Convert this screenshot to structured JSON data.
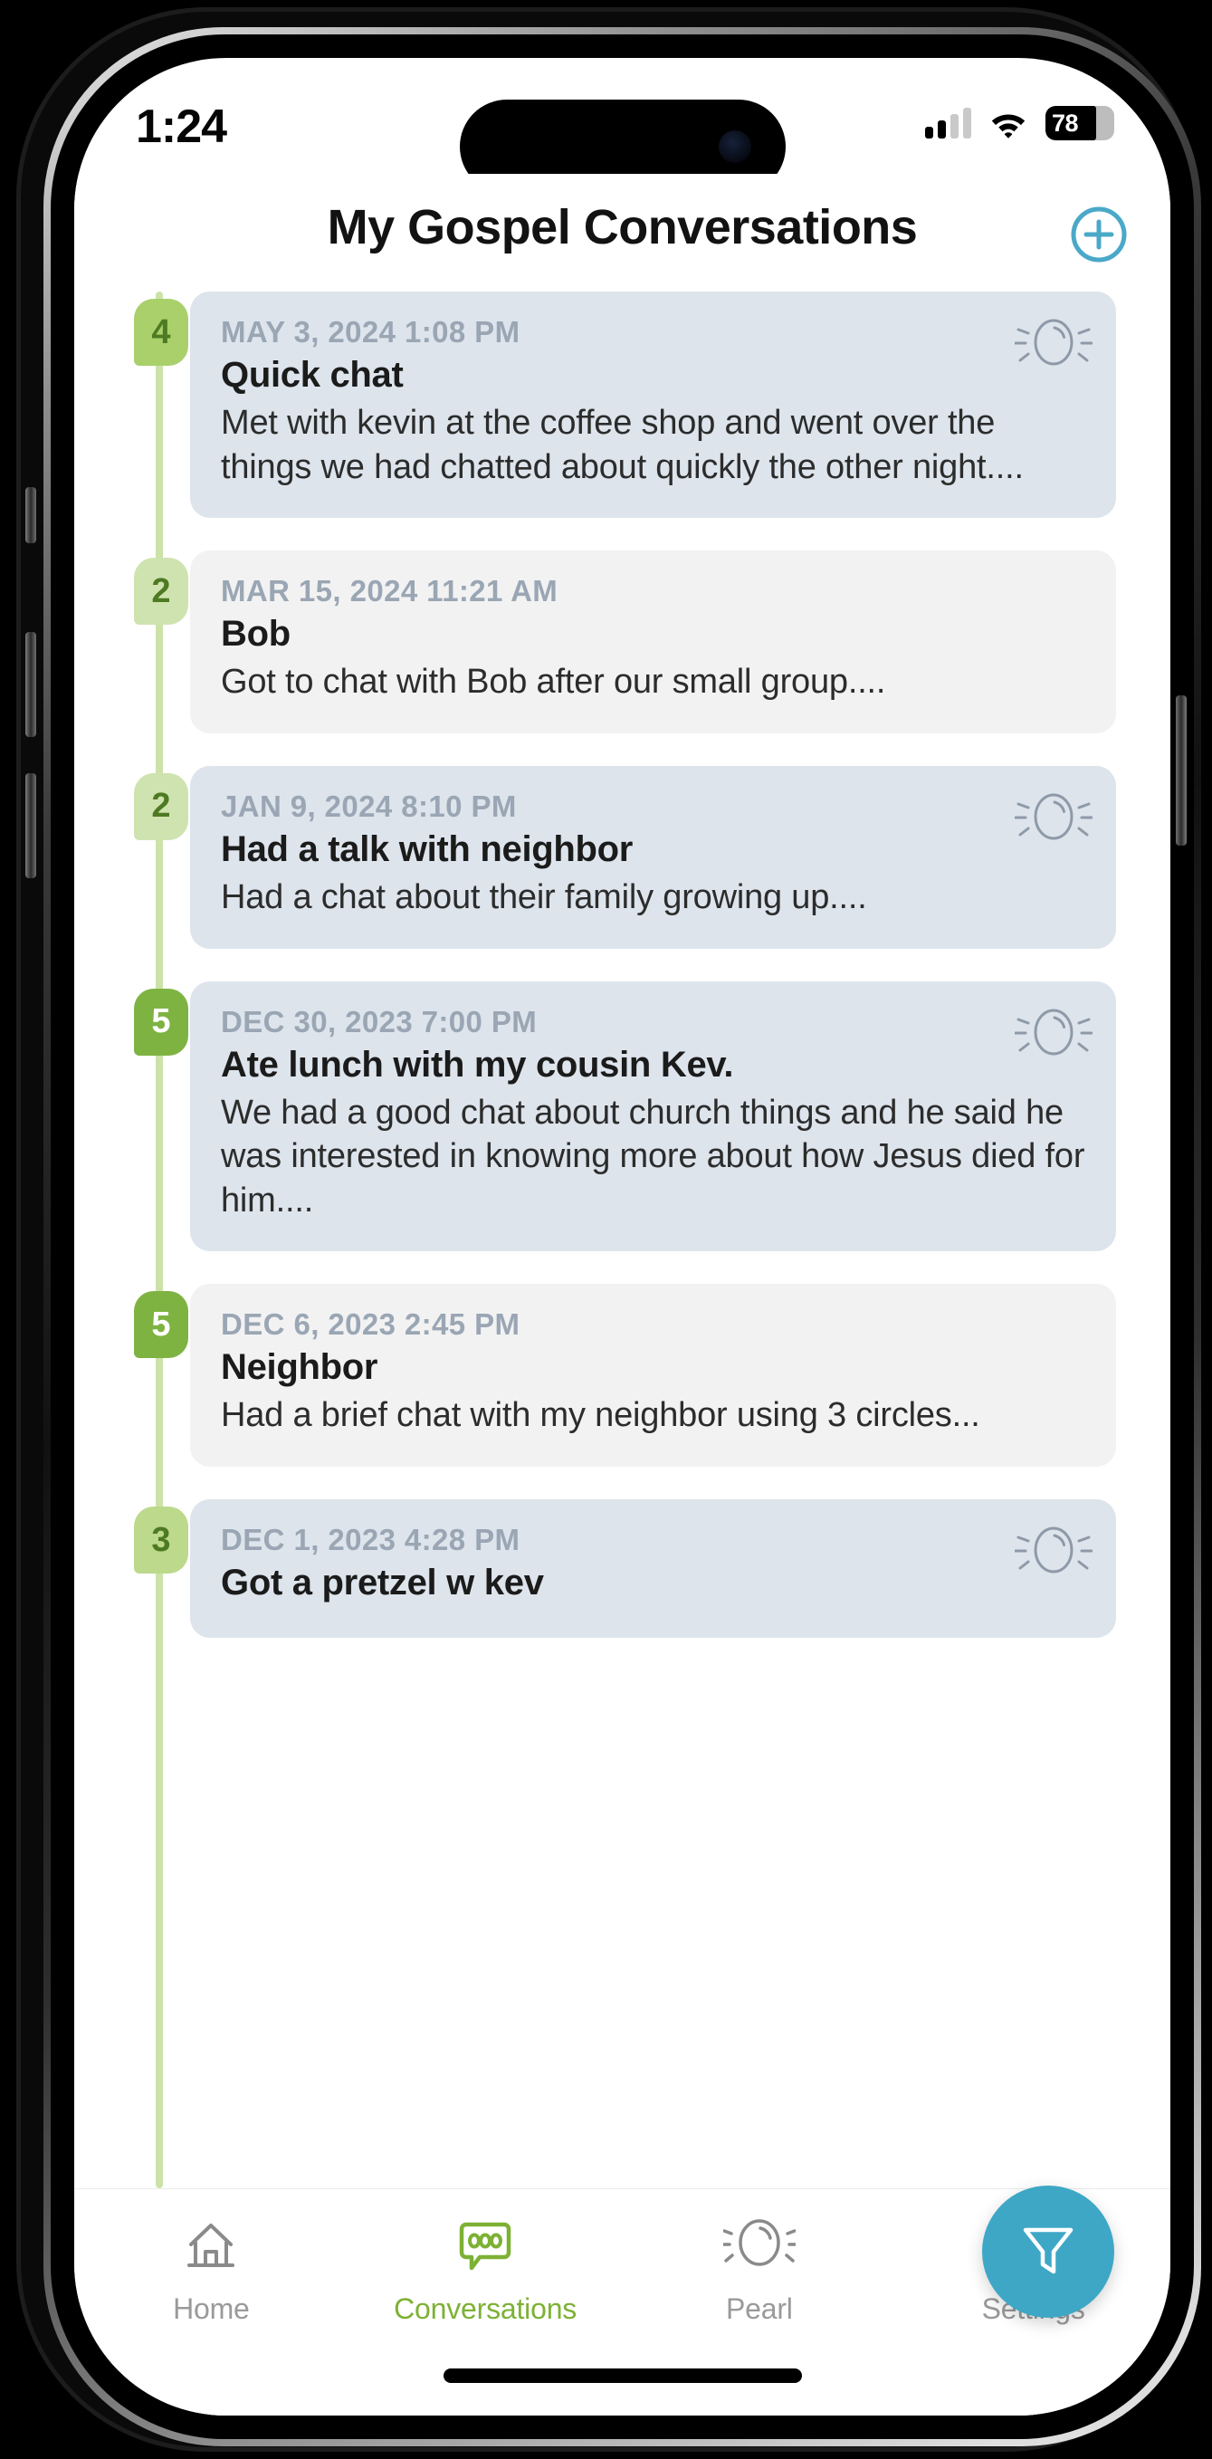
{
  "status_bar": {
    "time": "1:24",
    "battery_percent": "78",
    "cellular_icon": "cellular-signal-icon",
    "wifi_icon": "wifi-icon",
    "battery_icon": "battery-icon",
    "signal_bars_filled": 2,
    "signal_bars_total": 4
  },
  "header": {
    "title": "My Gospel Conversations",
    "add_icon": "plus-circle-icon",
    "accent_color": "#4aa8c8"
  },
  "theme": {
    "rail_color": "#cde2a8",
    "card_blue": "#dde4ec",
    "card_gray": "#f2f2f2",
    "badge_light": "#cfe3b0",
    "badge_medium": "#a9d06b",
    "badge_strong": "#7eb342",
    "fab_color": "#3ea7c6",
    "active_nav_color": "#7db135"
  },
  "conversations": [
    {
      "badge": "4",
      "badge_level": "medium",
      "date": "MAY 3, 2024 1:08 PM",
      "title": "Quick chat",
      "preview": "Met with kevin at the coffee shop and went over the things we had chatted about quickly the other night....",
      "card_style": "blue",
      "has_pearl": true
    },
    {
      "badge": "2",
      "badge_level": "light",
      "date": "MAR 15, 2024 11:21 AM",
      "title": "Bob",
      "preview": "Got to chat with Bob after our small group....",
      "card_style": "gray",
      "has_pearl": false
    },
    {
      "badge": "2",
      "badge_level": "light",
      "date": "JAN 9, 2024 8:10 PM",
      "title": "Had a talk with neighbor",
      "preview": "Had a chat about their family growing up....",
      "card_style": "blue",
      "has_pearl": true
    },
    {
      "badge": "5",
      "badge_level": "strong",
      "date": "DEC 30, 2023 7:00 PM",
      "title": "Ate lunch with my cousin Kev.",
      "preview": "We had a good chat about church things and he said he was interested in knowing more about how Jesus died for him....",
      "card_style": "blue",
      "has_pearl": true
    },
    {
      "badge": "5",
      "badge_level": "strong",
      "date": "DEC 6, 2023 2:45 PM",
      "title": "Neighbor",
      "preview": "Had a brief chat with my neighbor using 3 circles...",
      "card_style": "gray",
      "has_pearl": false
    },
    {
      "badge": "3",
      "badge_level": "medium-light",
      "date": "DEC 1, 2023 4:28 PM",
      "title": "Got a pretzel w kev",
      "preview": "",
      "card_style": "blue",
      "has_pearl": true
    }
  ],
  "filter_fab": {
    "icon": "filter-funnel-icon",
    "label": "Filter"
  },
  "bottom_nav": {
    "items": [
      {
        "label": "Home",
        "icon": "home-icon",
        "active": false
      },
      {
        "label": "Conversations",
        "icon": "chat-bubble-icon",
        "active": true
      },
      {
        "label": "Pearl",
        "icon": "pearl-icon",
        "active": false
      },
      {
        "label": "Settings",
        "icon": "gear-icon",
        "active": false
      }
    ]
  }
}
